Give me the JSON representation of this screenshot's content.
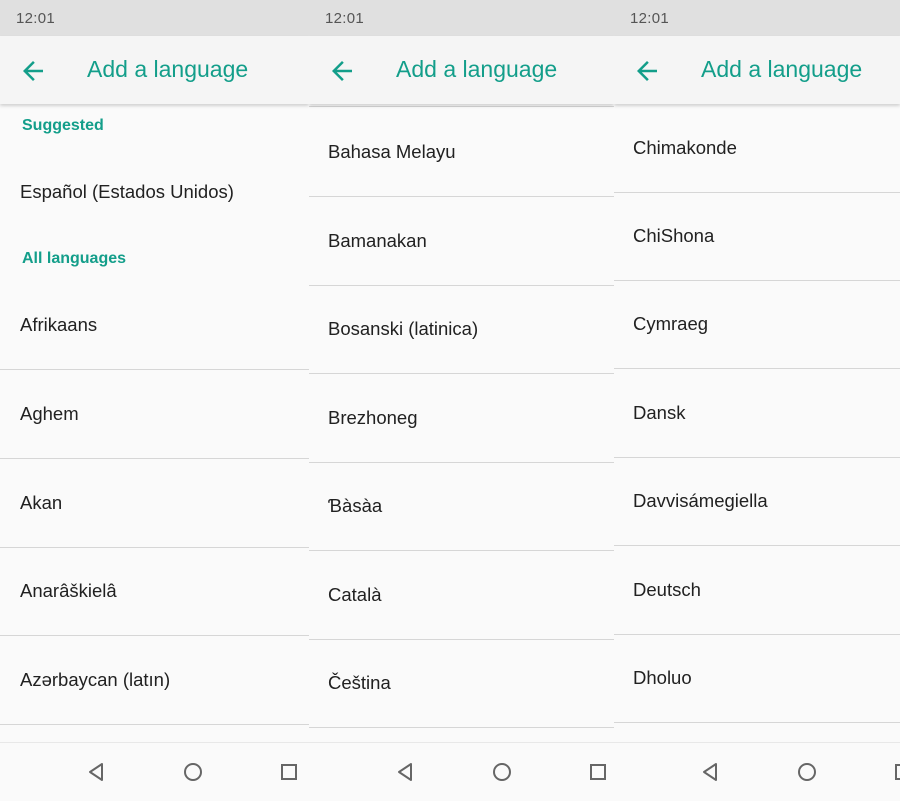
{
  "screens": [
    {
      "time": "12:01",
      "title": "Add a language",
      "sections": {
        "suggested": "Suggested",
        "all": "All languages"
      },
      "suggested_items": [
        "Español (Estados Unidos)"
      ],
      "items": [
        "Afrikaans",
        "Aghem",
        "Akan",
        "Anarâškielâ",
        "Azərbaycan (latın)"
      ]
    },
    {
      "time": "12:01",
      "title": "Add a language",
      "items": [
        "Bahasa Melayu",
        "Bamanakan",
        "Bosanski (latinica)",
        "Brezhoneg",
        "Ɓàsàa",
        "Català",
        "Čeština"
      ]
    },
    {
      "time": "12:01",
      "title": "Add a language",
      "items": [
        "Chimakonde",
        "ChiShona",
        "Cymraeg",
        "Dansk",
        "Davvisámegiella",
        "Deutsch",
        "Dholuo"
      ]
    }
  ],
  "icons": {
    "back": "arrow-left-icon",
    "nav_back": "triangle-back-icon",
    "nav_home": "circle-home-icon",
    "nav_recents": "square-recents-icon"
  },
  "colors": {
    "accent": "#139e8a",
    "status_bar": "#e0e0e0",
    "background": "#fafafa",
    "divider": "#d6d6d6",
    "text": "#212121"
  }
}
